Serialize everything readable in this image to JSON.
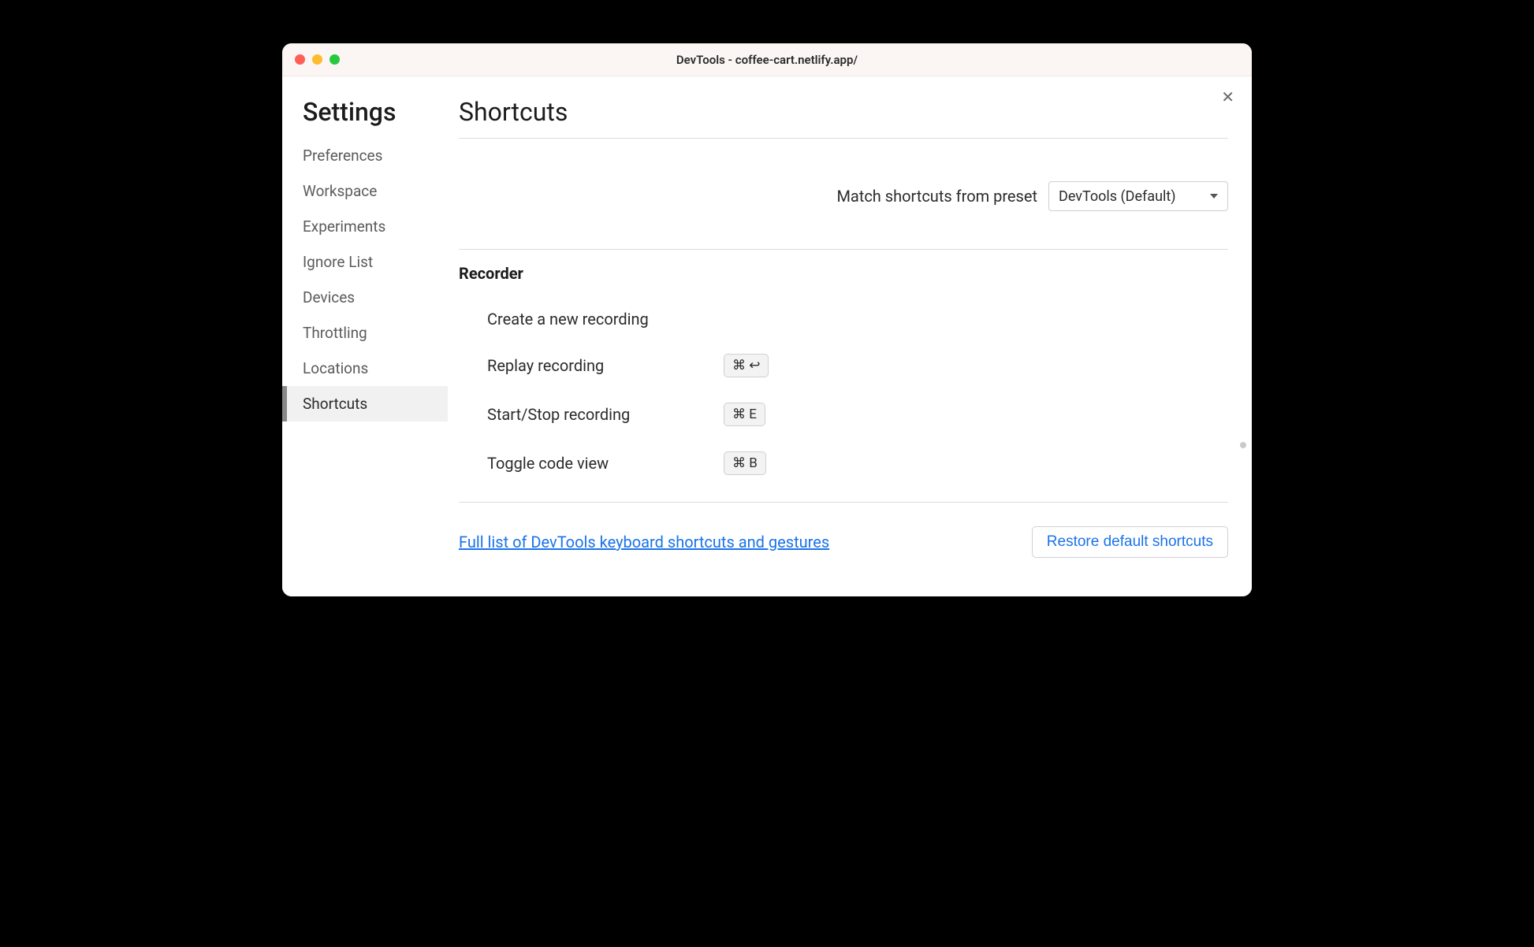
{
  "window": {
    "title": "DevTools - coffee-cart.netlify.app/"
  },
  "sidebar": {
    "title": "Settings",
    "items": [
      {
        "label": "Preferences",
        "active": false
      },
      {
        "label": "Workspace",
        "active": false
      },
      {
        "label": "Experiments",
        "active": false
      },
      {
        "label": "Ignore List",
        "active": false
      },
      {
        "label": "Devices",
        "active": false
      },
      {
        "label": "Throttling",
        "active": false
      },
      {
        "label": "Locations",
        "active": false
      },
      {
        "label": "Shortcuts",
        "active": true
      }
    ]
  },
  "main": {
    "title": "Shortcuts",
    "preset_label": "Match shortcuts from preset",
    "preset_value": "DevTools (Default)",
    "section_title": "Recorder",
    "shortcuts": [
      {
        "label": "Create a new recording",
        "keys": ""
      },
      {
        "label": "Replay recording",
        "keys": "⌘  ↩"
      },
      {
        "label": "Start/Stop recording",
        "keys": "⌘  E"
      },
      {
        "label": "Toggle code view",
        "keys": "⌘  B"
      }
    ],
    "footer_link": "Full list of DevTools keyboard shortcuts and gestures",
    "restore_button": "Restore default shortcuts"
  }
}
